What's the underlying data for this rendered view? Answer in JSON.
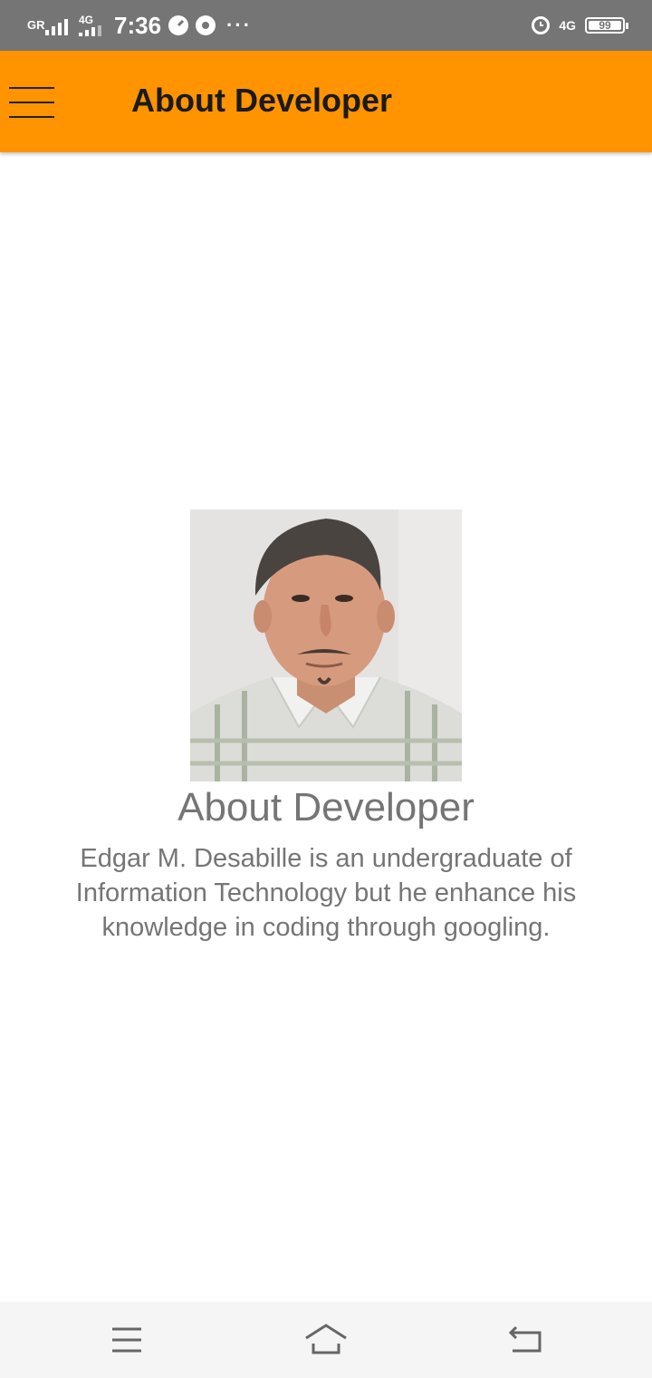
{
  "status_bar": {
    "signal_label": "GR",
    "network_label": "4G",
    "time": "7:36",
    "more": "···",
    "network_right": "4G",
    "battery": "99",
    "icons": [
      "signal-icon",
      "signal-4g-icon",
      "speedometer-icon",
      "chrome-icon",
      "alarm-icon",
      "battery-icon"
    ]
  },
  "appbar": {
    "title": "About Developer",
    "menu_icon": "hamburger-menu-icon",
    "color": "#ff9400"
  },
  "content": {
    "photo_alt": "developer-photo",
    "title": "About Developer",
    "description": "Edgar M. Desabille is an undergraduate of Information Technology but he enhance his knowledge in coding through googling."
  },
  "navbar": {
    "icons": [
      "menu-icon",
      "home-icon",
      "back-icon"
    ]
  }
}
